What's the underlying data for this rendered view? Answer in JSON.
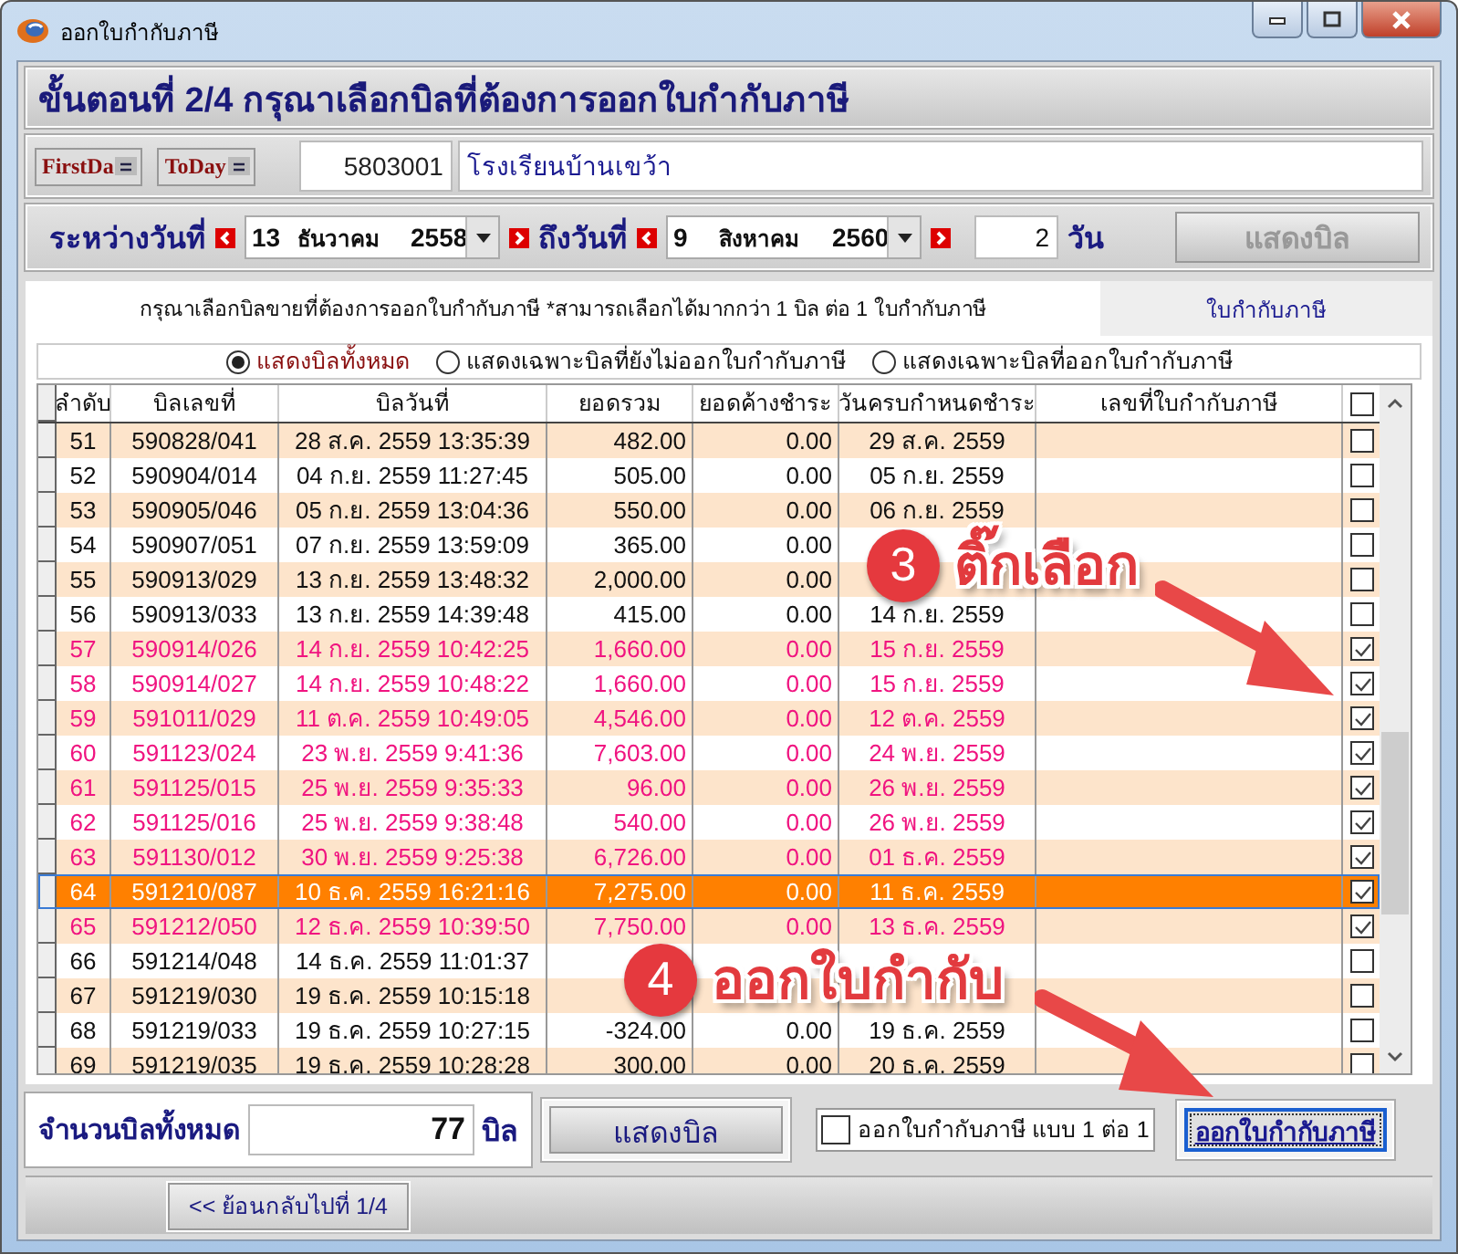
{
  "window": {
    "title": "ออกใบกำกับภาษี"
  },
  "heading": "ขั้นตอนที่ 2/4 กรุณาเลือกบิลที่ต้องการออกใบกำกับภาษี",
  "customer": {
    "buttons": [
      "FirstDa",
      "ToDay"
    ],
    "code": "5803001",
    "name": "โรงเรียนบ้านเขว้า"
  },
  "date_range": {
    "from_label": "ระหว่างวันที่",
    "from": [
      "13",
      "ธันวาคม",
      "2558"
    ],
    "to_label": "ถึงวันที่",
    "to": [
      "9",
      "สิงหาคม",
      "2560"
    ],
    "days": "2",
    "days_unit": "วัน",
    "show_button": {
      "label": "แสดงบิล",
      "disabled": true
    }
  },
  "tabs": [
    {
      "label": "กรุณาเลือกบิลขายที่ต้องการออกใบกำกับภาษี  *สามารถเลือกได้มากกว่า 1 บิล ต่อ 1 ใบกำกับภาษี",
      "selected": true
    },
    {
      "label": "ใบกำกับภาษี",
      "selected": false
    }
  ],
  "filters": [
    {
      "label": "แสดงบิลทั้งหมด",
      "selected": true
    },
    {
      "label": "แสดงเฉพาะบิลที่ยังไม่ออกใบกำกับภาษี",
      "selected": false
    },
    {
      "label": "แสดงเฉพาะบิลที่ออกใบกำกับภาษี",
      "selected": false
    }
  ],
  "table": {
    "columns": [
      "ลำดับ",
      "บิลเลขที่",
      "บิลวันที่",
      "ยอดรวม",
      "ยอดค้างชำระ",
      "วันครบกำหนดชำระ",
      "เลขที่ใบกำกับภาษี"
    ],
    "all_checked": false,
    "rows": [
      {
        "cells": [
          "51",
          "590828/041",
          "28 ส.ค. 2559 13:35:39",
          "482.00",
          "0.00",
          "29 ส.ค. 2559"
        ],
        "checked": false,
        "selected": false
      },
      {
        "cells": [
          "52",
          "590904/014",
          "04 ก.ย. 2559 11:27:45",
          "505.00",
          "0.00",
          "05 ก.ย. 2559"
        ],
        "checked": false,
        "selected": false
      },
      {
        "cells": [
          "53",
          "590905/046",
          "05 ก.ย. 2559 13:04:36",
          "550.00",
          "0.00",
          "06 ก.ย. 2559"
        ],
        "checked": false,
        "selected": false
      },
      {
        "cells": [
          "54",
          "590907/051",
          "07 ก.ย. 2559 13:59:09",
          "365.00",
          "0.00",
          null
        ],
        "checked": false,
        "selected": false
      },
      {
        "cells": [
          "55",
          "590913/029",
          "13 ก.ย. 2559 13:48:32",
          "2,000.00",
          "0.00",
          null
        ],
        "checked": false,
        "selected": false
      },
      {
        "cells": [
          "56",
          "590913/033",
          "13 ก.ย. 2559 14:39:48",
          "415.00",
          "0.00",
          "14 ก.ย. 2559"
        ],
        "checked": false,
        "selected": false
      },
      {
        "cells": [
          "57",
          "590914/026",
          "14 ก.ย. 2559 10:42:25",
          "1,660.00",
          "0.00",
          "15 ก.ย. 2559"
        ],
        "checked": true,
        "selected": false
      },
      {
        "cells": [
          "58",
          "590914/027",
          "14 ก.ย. 2559 10:48:22",
          "1,660.00",
          "0.00",
          "15 ก.ย. 2559"
        ],
        "checked": true,
        "selected": false
      },
      {
        "cells": [
          "59",
          "591011/029",
          "11 ต.ค. 2559 10:49:05",
          "4,546.00",
          "0.00",
          "12 ต.ค. 2559"
        ],
        "checked": true,
        "selected": false
      },
      {
        "cells": [
          "60",
          "591123/024",
          "23 พ.ย. 2559 9:41:36",
          "7,603.00",
          "0.00",
          "24 พ.ย. 2559"
        ],
        "checked": true,
        "selected": false
      },
      {
        "cells": [
          "61",
          "591125/015",
          "25 พ.ย. 2559 9:35:33",
          "96.00",
          "0.00",
          "26 พ.ย. 2559"
        ],
        "checked": true,
        "selected": false
      },
      {
        "cells": [
          "62",
          "591125/016",
          "25 พ.ย. 2559 9:38:48",
          "540.00",
          "0.00",
          "26 พ.ย. 2559"
        ],
        "checked": true,
        "selected": false
      },
      {
        "cells": [
          "63",
          "591130/012",
          "30 พ.ย. 2559 9:25:38",
          "6,726.00",
          "0.00",
          "01 ธ.ค. 2559"
        ],
        "checked": true,
        "selected": false
      },
      {
        "cells": [
          "64",
          "591210/087",
          "10 ธ.ค. 2559 16:21:16",
          "7,275.00",
          "0.00",
          "11 ธ.ค. 2559"
        ],
        "checked": true,
        "selected": true
      },
      {
        "cells": [
          "65",
          "591212/050",
          "12 ธ.ค. 2559 10:39:50",
          "7,750.00",
          "0.00",
          "13 ธ.ค. 2559"
        ],
        "checked": true,
        "selected": false
      },
      {
        "cells": [
          "66",
          "591214/048",
          "14 ธ.ค. 2559 11:01:37",
          null,
          null,
          null
        ],
        "checked": false,
        "selected": false
      },
      {
        "cells": [
          "67",
          "591219/030",
          "19 ธ.ค. 2559 10:15:18",
          null,
          null,
          null
        ],
        "checked": false,
        "selected": false
      },
      {
        "cells": [
          "68",
          "591219/033",
          "19 ธ.ค. 2559 10:27:15",
          "-324.00",
          "0.00",
          "19 ธ.ค. 2559"
        ],
        "checked": false,
        "selected": false
      },
      {
        "cells": [
          "69",
          "591219/035",
          "19 ธ.ค. 2559 10:28:28",
          "300.00",
          "0.00",
          "20 ธ.ค. 2559"
        ],
        "checked": false,
        "selected": false
      }
    ]
  },
  "footer": {
    "total_label": "จำนวนบิลทั้งหมด",
    "total": "77",
    "total_unit": "บิล",
    "show_button": "แสดงบิล",
    "one_to_one": {
      "label": "ออกใบกำกับภาษี แบบ 1 ต่อ 1",
      "checked": false
    },
    "issue_button": "ออกใบกำกับภาษี",
    "back_button": "<< ย้อนกลับไปที่ 1/4"
  },
  "annotations": [
    {
      "number": "3",
      "text": "ติ๊กเลือก"
    },
    {
      "number": "4",
      "text": "ออกใบกำกับ"
    }
  ]
}
